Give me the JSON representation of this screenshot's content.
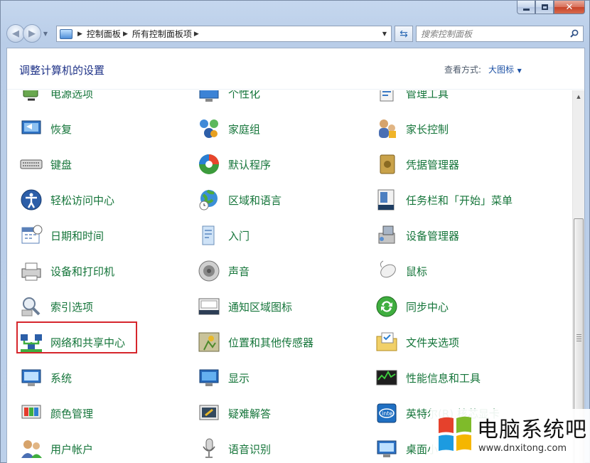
{
  "window": {
    "address": {
      "crumbs": [
        "控制面板",
        "所有控制面板项"
      ]
    },
    "search": {
      "placeholder": "搜索控制面板"
    }
  },
  "header": {
    "title": "调整计算机的设置",
    "view_by_label": "查看方式:",
    "view_by_value": "大图标"
  },
  "items": [
    {
      "id": "power",
      "label": "电源选项",
      "icon": "power-options-icon"
    },
    {
      "id": "personalize",
      "label": "个性化",
      "icon": "personalization-icon"
    },
    {
      "id": "admin-tools",
      "label": "管理工具",
      "icon": "admin-tools-icon"
    },
    {
      "id": "recovery",
      "label": "恢复",
      "icon": "recovery-icon"
    },
    {
      "id": "homegroup",
      "label": "家庭组",
      "icon": "homegroup-icon"
    },
    {
      "id": "parental",
      "label": "家长控制",
      "icon": "parental-controls-icon"
    },
    {
      "id": "keyboard",
      "label": "键盘",
      "icon": "keyboard-icon"
    },
    {
      "id": "default-programs",
      "label": "默认程序",
      "icon": "default-programs-icon"
    },
    {
      "id": "credentials",
      "label": "凭据管理器",
      "icon": "credential-manager-icon"
    },
    {
      "id": "ease-access",
      "label": "轻松访问中心",
      "icon": "ease-of-access-icon"
    },
    {
      "id": "region",
      "label": "区域和语言",
      "icon": "region-language-icon"
    },
    {
      "id": "taskbar",
      "label": "任务栏和「开始」菜单",
      "icon": "taskbar-icon"
    },
    {
      "id": "datetime",
      "label": "日期和时间",
      "icon": "date-time-icon"
    },
    {
      "id": "getting-started",
      "label": "入门",
      "icon": "getting-started-icon"
    },
    {
      "id": "device-manager",
      "label": "设备管理器",
      "icon": "device-manager-icon"
    },
    {
      "id": "devices-printers",
      "label": "设备和打印机",
      "icon": "devices-printers-icon"
    },
    {
      "id": "sound",
      "label": "声音",
      "icon": "sound-icon"
    },
    {
      "id": "mouse",
      "label": "鼠标",
      "icon": "mouse-icon"
    },
    {
      "id": "indexing",
      "label": "索引选项",
      "icon": "indexing-icon"
    },
    {
      "id": "notification",
      "label": "通知区域图标",
      "icon": "notification-area-icon"
    },
    {
      "id": "sync",
      "label": "同步中心",
      "icon": "sync-center-icon"
    },
    {
      "id": "network",
      "label": "网络和共享中心",
      "icon": "network-sharing-icon"
    },
    {
      "id": "location",
      "label": "位置和其他传感器",
      "icon": "location-sensors-icon"
    },
    {
      "id": "folder-options",
      "label": "文件夹选项",
      "icon": "folder-options-icon"
    },
    {
      "id": "system",
      "label": "系统",
      "icon": "system-icon"
    },
    {
      "id": "display",
      "label": "显示",
      "icon": "display-icon"
    },
    {
      "id": "performance",
      "label": "性能信息和工具",
      "icon": "performance-icon"
    },
    {
      "id": "color",
      "label": "颜色管理",
      "icon": "color-management-icon"
    },
    {
      "id": "troubleshoot",
      "label": "疑难解答",
      "icon": "troubleshooting-icon"
    },
    {
      "id": "intel-graphics",
      "label": "英特尔(R) 核芯显卡",
      "icon": "intel-graphics-icon"
    },
    {
      "id": "user-accounts",
      "label": "用户帐户",
      "icon": "user-accounts-icon"
    },
    {
      "id": "speech",
      "label": "语音识别",
      "icon": "speech-recognition-icon"
    },
    {
      "id": "desktop-gadgets",
      "label": "桌面小",
      "icon": "desktop-gadgets-icon"
    }
  ],
  "watermark": {
    "title": "电脑系统吧",
    "url": "www.dnxitong.com"
  },
  "colors": {
    "item_text": "#15753a",
    "title_text": "#1e3287",
    "link_blue": "#1c51a5",
    "highlight_border": "#d6262c"
  }
}
